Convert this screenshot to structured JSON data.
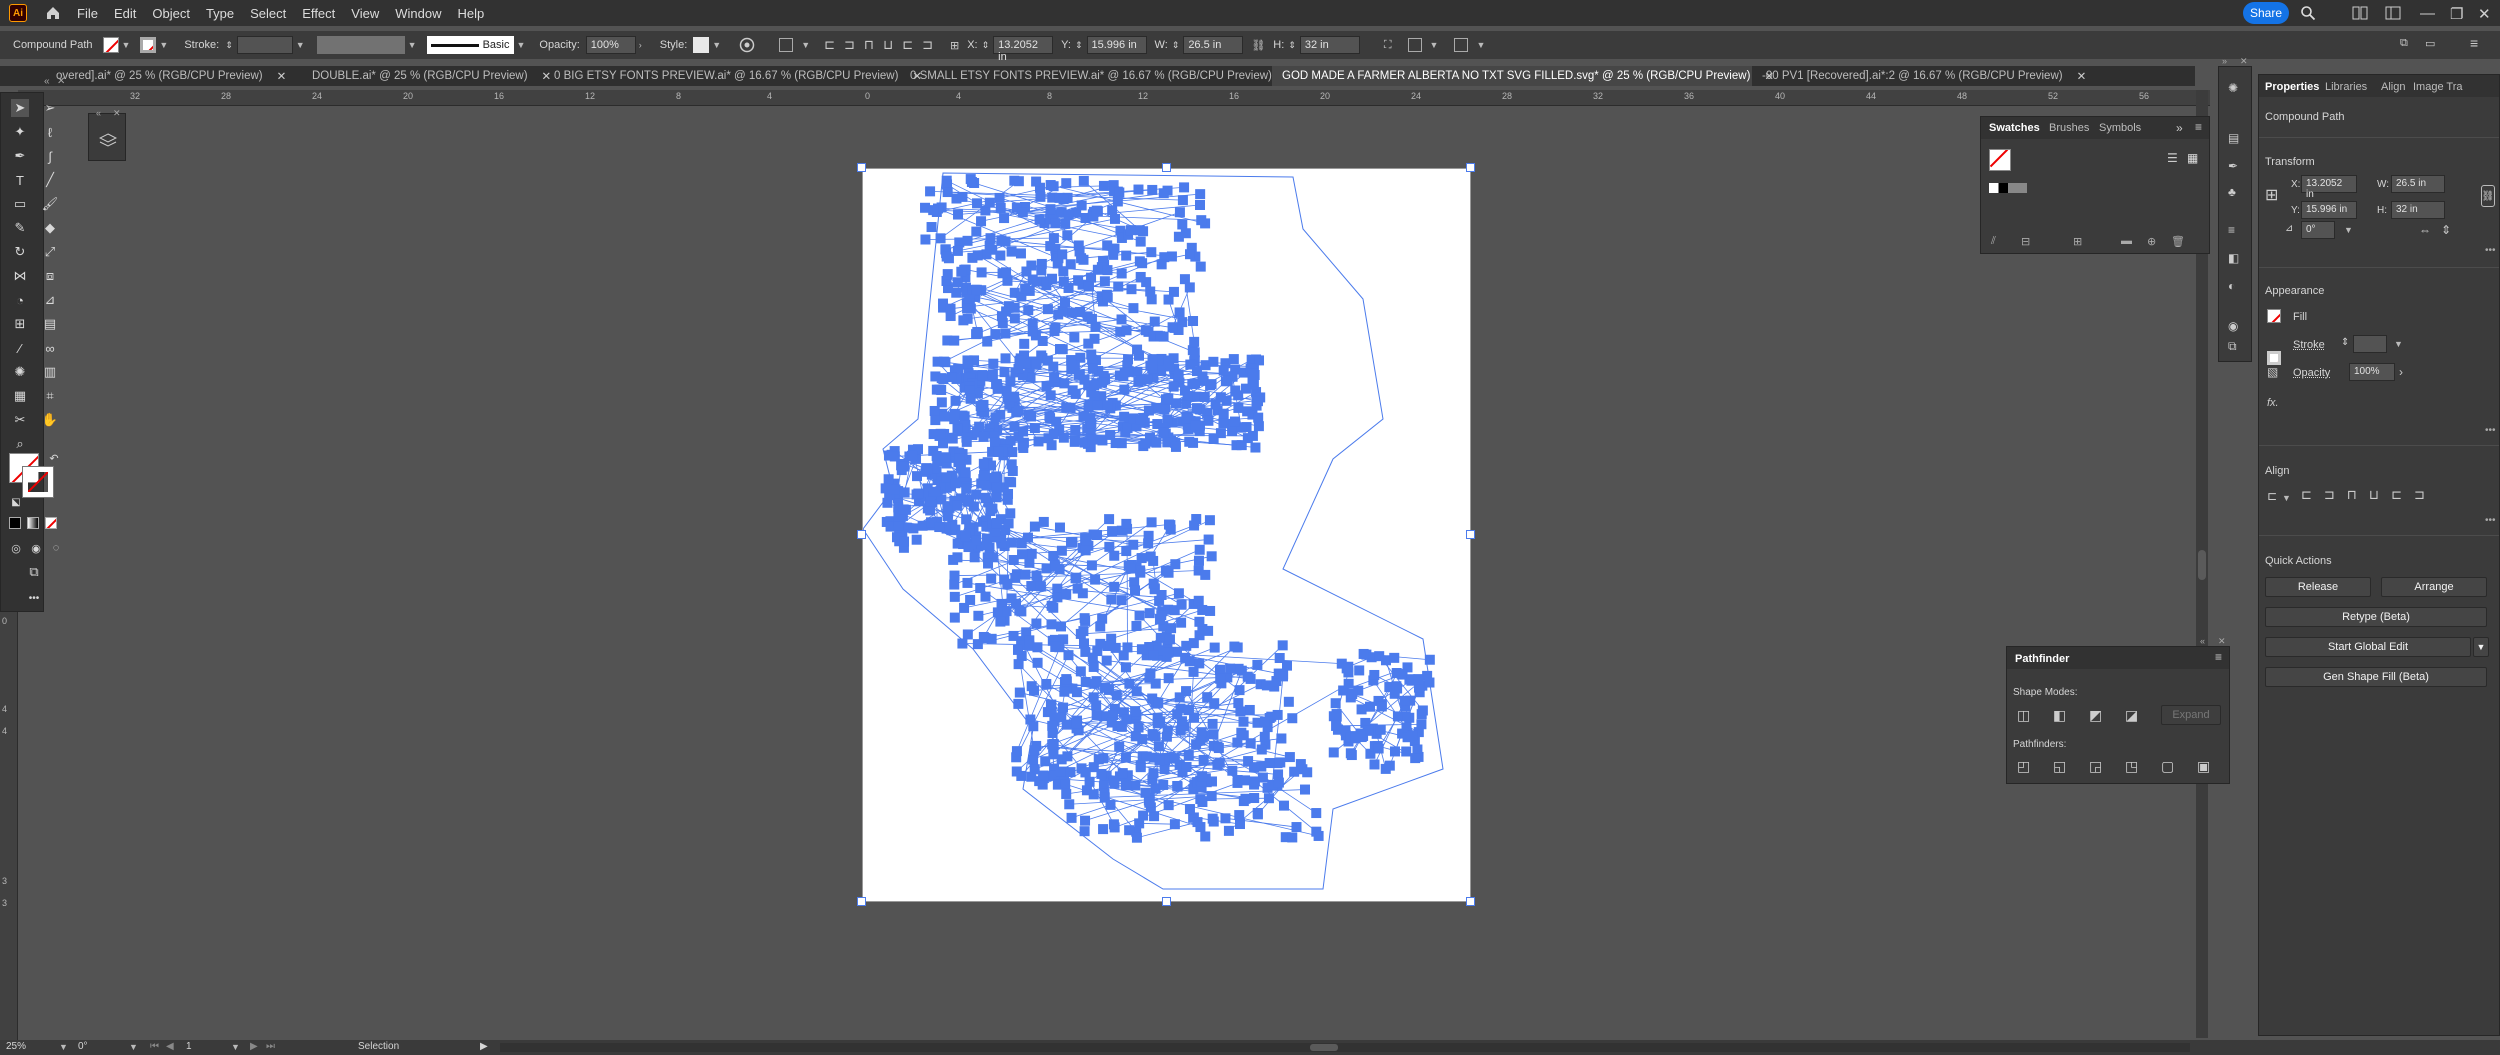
{
  "app": {
    "logo": "Ai",
    "share": "Share"
  },
  "menu": [
    "File",
    "Edit",
    "Object",
    "Type",
    "Select",
    "Effect",
    "View",
    "Window",
    "Help"
  ],
  "control_bar": {
    "selection_type": "Compound Path",
    "stroke_label": "Stroke:",
    "stroke_weight_value": "",
    "brush_label": "Basic",
    "opacity_label": "Opacity:",
    "opacity_value": "100%",
    "style_label": "Style:",
    "x_label": "X:",
    "x_value": "13.2052 in",
    "y_label": "Y:",
    "y_value": "15.996 in",
    "w_label": "W:",
    "w_value": "26.5 in",
    "h_label": "H:",
    "h_value": "32 in"
  },
  "tabs": [
    {
      "label": "overed].ai* @ 25 % (RGB/CPU Preview)",
      "active": false
    },
    {
      "label": "DOUBLE.ai* @ 25 % (RGB/CPU Preview)",
      "active": false
    },
    {
      "label": "0 BIG ETSY FONTS PREVIEW.ai* @ 16.67 % (RGB/CPU Preview)",
      "active": false
    },
    {
      "label": "0 SMALL ETSY FONTS PREVIEW.ai* @ 16.67 % (RGB/CPU Preview)",
      "active": false
    },
    {
      "label": "GOD MADE A FARMER ALBERTA NO TXT SVG FILLED.svg* @ 25 % (RGB/CPU Preview)",
      "active": true
    },
    {
      "label": "-00 PV1 [Recovered].ai*:2 @ 16.67 % (RGB/CPU Preview)",
      "active": false
    }
  ],
  "ruler_top_labels": [
    "32",
    "28",
    "24",
    "20",
    "16",
    "12",
    "8",
    "4",
    "0",
    "4",
    "8",
    "12",
    "16",
    "20",
    "24",
    "28",
    "32",
    "36",
    "40",
    "44",
    "48",
    "52",
    "56"
  ],
  "ruler_left_labels": [
    "0",
    "4",
    "4",
    "3",
    "3"
  ],
  "swatches_panel": {
    "tabs": [
      "Swatches",
      "Brushes",
      "Symbols"
    ]
  },
  "properties_panel": {
    "tabs": [
      "Properties",
      "Libraries",
      "Align",
      "Image Tra"
    ],
    "object_type": "Compound Path",
    "transform_title": "Transform",
    "x_label": "X:",
    "x_value": "13.2052 in",
    "y_label": "Y:",
    "y_value": "15.996 in",
    "w_label": "W:",
    "w_value": "26.5 in",
    "h_label": "H:",
    "h_value": "32 in",
    "angle_value": "0°",
    "appearance_title": "Appearance",
    "fill_label": "Fill",
    "stroke_label": "Stroke",
    "opacity_label": "Opacity",
    "opacity_value": "100%",
    "fx_label": "fx.",
    "align_title": "Align",
    "quick_actions_title": "Quick Actions",
    "release": "Release",
    "arrange": "Arrange",
    "retype": "Retype (Beta)",
    "start_global_edit": "Start Global Edit",
    "gen_shape_fill": "Gen Shape Fill (Beta)"
  },
  "pathfinder_panel": {
    "title": "Pathfinder",
    "shape_modes": "Shape Modes:",
    "expand": "Expand",
    "pathfinders": "Pathfinders:"
  },
  "status_bar": {
    "zoom": "25%",
    "angle": "0°",
    "artboard": "1",
    "tool": "Selection"
  },
  "colors": {
    "accent": "#1473e6",
    "selection": "#4b7bec",
    "panel_bg": "#3b3b3b",
    "canvas_bg": "#535353"
  }
}
